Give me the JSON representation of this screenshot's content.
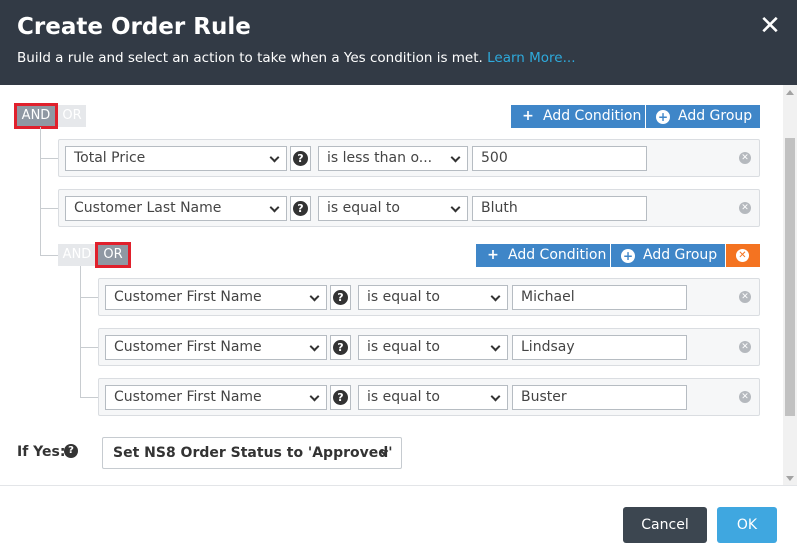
{
  "header": {
    "title": "Create Order Rule",
    "subtitle": "Build a rule and select an action to take when a Yes condition is met.",
    "learn_more": "Learn More...",
    "close_glyph": "✕"
  },
  "root_group": {
    "toggle_and": "AND",
    "toggle_or": "OR",
    "active": "AND",
    "add_condition": "Add Condition",
    "add_group": "Add Group",
    "conditions": [
      {
        "field": "Total Price",
        "operator": "is less than o...",
        "value": "500"
      },
      {
        "field": "Customer Last Name",
        "operator": "is equal to",
        "value": "Bluth"
      }
    ]
  },
  "sub_group": {
    "toggle_and": "AND",
    "toggle_or": "OR",
    "active": "OR",
    "add_condition": "Add Condition",
    "add_group": "Add Group",
    "conditions": [
      {
        "field": "Customer First Name",
        "operator": "is equal to",
        "value": "Michael"
      },
      {
        "field": "Customer First Name",
        "operator": "is equal to",
        "value": "Lindsay"
      },
      {
        "field": "Customer First Name",
        "operator": "is equal to",
        "value": "Buster"
      }
    ]
  },
  "if_yes": {
    "label": "If Yes:",
    "action": "Set NS8 Order Status to 'Approved'"
  },
  "footer": {
    "cancel": "Cancel",
    "ok": "OK"
  },
  "icons": {
    "plus": "+",
    "help": "?",
    "remove": "✕"
  },
  "colors": {
    "header_bg": "#323a45",
    "primary_button": "#3f86c8",
    "delete_button": "#f47321",
    "ok_button": "#3fa7e0",
    "cancel_button": "#3c4650",
    "highlight": "#e0202c"
  }
}
